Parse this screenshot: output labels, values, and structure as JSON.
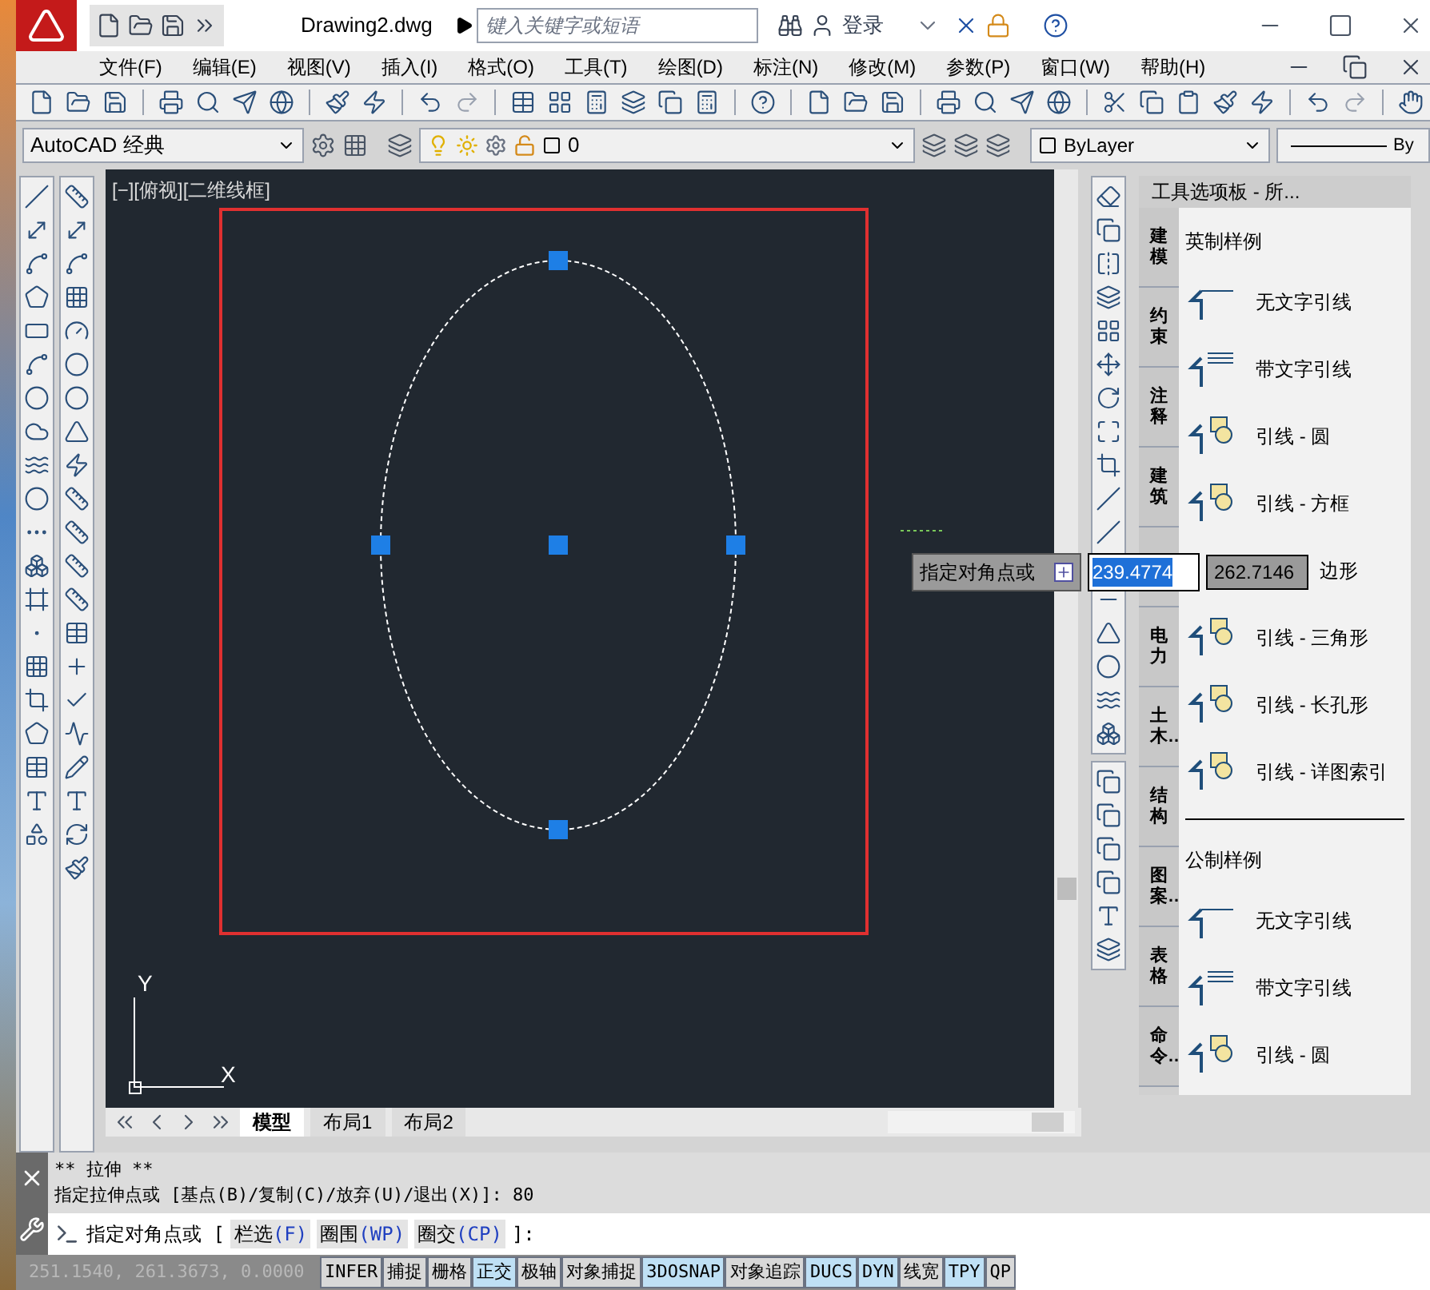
{
  "window": {
    "title": "Drawing2.dwg",
    "search": {
      "placeholder": "键入关键字或短语"
    },
    "login": "登录"
  },
  "menu": [
    {
      "label": "文件(F)"
    },
    {
      "label": "编辑(E)"
    },
    {
      "label": "视图(V)"
    },
    {
      "label": "插入(I)"
    },
    {
      "label": "格式(O)"
    },
    {
      "label": "工具(T)"
    },
    {
      "label": "绘图(D)"
    },
    {
      "label": "标注(N)"
    },
    {
      "label": "修改(M)"
    },
    {
      "label": "参数(P)"
    },
    {
      "label": "窗口(W)"
    },
    {
      "label": "帮助(H)"
    }
  ],
  "properties_bar": {
    "workspace": "AutoCAD 经典",
    "layer": "0",
    "color_property": "ByLayer",
    "linetype": "By"
  },
  "viewport": {
    "label": "[−][俯视][二维线框]",
    "ucs_y": "Y",
    "ucs_x": "X"
  },
  "dynamic_input": {
    "prompt": "指定对角点或",
    "value_1": "239.4774",
    "value_2": "262.7146"
  },
  "layout_tabs": [
    {
      "label": "模型",
      "selected": true
    },
    {
      "label": "布局1",
      "selected": false
    },
    {
      "label": "布局2",
      "selected": false
    }
  ],
  "tool_palette": {
    "title": "工具选项板 - 所...",
    "tabs": [
      {
        "label": "建模"
      },
      {
        "label": "约束"
      },
      {
        "label": "注释"
      },
      {
        "label": "建筑"
      },
      {
        "covered": true
      },
      {
        "label": "电力"
      },
      {
        "label": "土木…"
      },
      {
        "label": "结构"
      },
      {
        "label": "图案…"
      },
      {
        "label": "表格"
      },
      {
        "label": "命令…"
      }
    ],
    "sections": [
      {
        "title": "英制样例",
        "items": [
          {
            "label": "无文字引线",
            "kind": "plain"
          },
          {
            "label": "带文字引线",
            "kind": "text"
          },
          {
            "label": "引线 - 圆",
            "kind": "block"
          },
          {
            "label": "引线 - 方框",
            "kind": "block"
          },
          {
            "label": "边形",
            "kind": "covered"
          },
          {
            "label": "引线 - 三角形",
            "kind": "block"
          },
          {
            "label": "引线 - 长孔形",
            "kind": "block"
          },
          {
            "label": "引线 - 详图索引",
            "kind": "block"
          }
        ]
      },
      {
        "title": "公制样例",
        "items": [
          {
            "label": "无文字引线",
            "kind": "plain"
          },
          {
            "label": "带文字引线",
            "kind": "text"
          },
          {
            "label": "引线 - 圆",
            "kind": "block"
          }
        ]
      }
    ]
  },
  "command_history": [
    "** 拉伸 **",
    "指定拉伸点或 [基点(B)/复制(C)/放弃(U)/退出(X)]: 80"
  ],
  "command_line": {
    "prompt": "指定对角点或 [",
    "options": [
      {
        "label": "栏选",
        "key": "(F)"
      },
      {
        "label": "圈围",
        "key": "(WP)"
      },
      {
        "label": "圈交",
        "key": "(CP)"
      }
    ],
    "suffix": "]:"
  },
  "status_bar": {
    "coordinates": "251.1540, 261.3673, 0.0000",
    "toggles": [
      {
        "label": "INFER",
        "on": false
      },
      {
        "label": "捕捉",
        "on": false
      },
      {
        "label": "栅格",
        "on": false
      },
      {
        "label": "正交",
        "on": true
      },
      {
        "label": "极轴",
        "on": false
      },
      {
        "label": "对象捕捉",
        "on": false
      },
      {
        "label": "3DOSNAP",
        "on": true
      },
      {
        "label": "对象追踪",
        "on": false
      },
      {
        "label": "DUCS",
        "on": true
      },
      {
        "label": "DYN",
        "on": true
      },
      {
        "label": "线宽",
        "on": false
      },
      {
        "label": "TPY",
        "on": true
      },
      {
        "label": "QP",
        "on": false
      }
    ]
  }
}
